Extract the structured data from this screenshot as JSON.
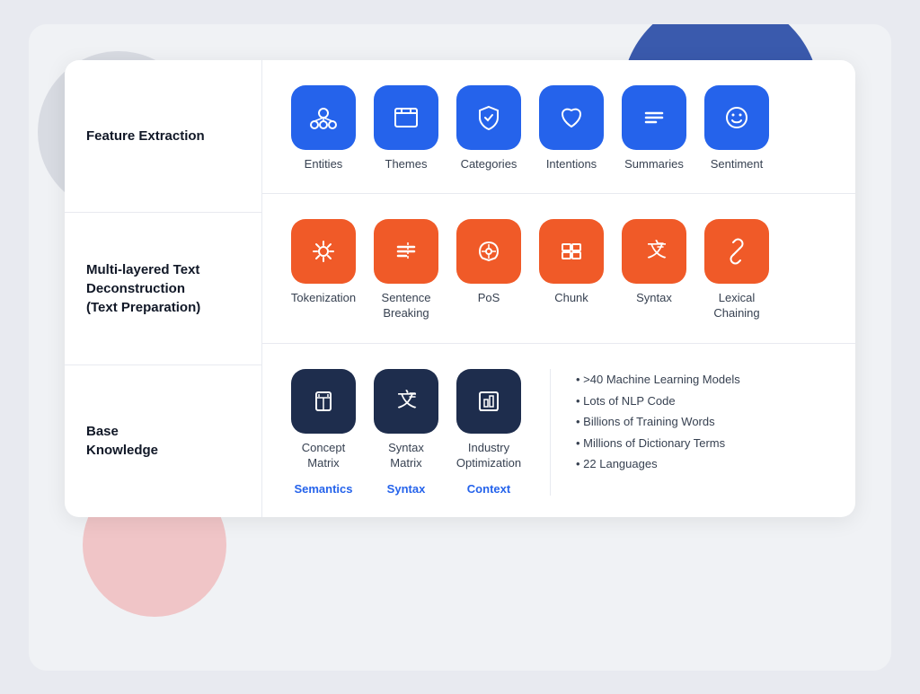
{
  "blobs": {
    "gray": "gray decorative circle",
    "blue": "blue decorative circle",
    "pink": "pink decorative circle"
  },
  "sidebar": {
    "items": [
      {
        "id": "feature-extraction",
        "label": "Feature\nExtraction"
      },
      {
        "id": "multi-layered",
        "label": "Multi-layered Text\nDeconstruction\n(Text Preparation)"
      },
      {
        "id": "base-knowledge",
        "label": "Base\nKnowledge"
      }
    ]
  },
  "sections": {
    "feature_extraction": {
      "icons": [
        {
          "id": "entities",
          "label": "Entities",
          "color": "blue"
        },
        {
          "id": "themes",
          "label": "Themes",
          "color": "blue"
        },
        {
          "id": "categories",
          "label": "Categories",
          "color": "blue"
        },
        {
          "id": "intentions",
          "label": "Intentions",
          "color": "blue"
        },
        {
          "id": "summaries",
          "label": "Summaries",
          "color": "blue"
        },
        {
          "id": "sentiment",
          "label": "Sentiment",
          "color": "blue"
        }
      ]
    },
    "text_preparation": {
      "icons": [
        {
          "id": "tokenization",
          "label": "Tokenization",
          "color": "orange"
        },
        {
          "id": "sentence-breaking",
          "label": "Sentence\nBreaking",
          "color": "orange"
        },
        {
          "id": "pos",
          "label": "PoS",
          "color": "orange"
        },
        {
          "id": "chunk",
          "label": "Chunk",
          "color": "orange"
        },
        {
          "id": "syntax",
          "label": "Syntax",
          "color": "orange"
        },
        {
          "id": "lexical-chaining",
          "label": "Lexical\nChaining",
          "color": "orange"
        }
      ]
    },
    "base_knowledge": {
      "icons": [
        {
          "id": "concept-matrix",
          "label": "Concept\nMatrix",
          "category": "Semantics"
        },
        {
          "id": "syntax-matrix",
          "label": "Syntax\nMatrix",
          "category": "Syntax"
        },
        {
          "id": "industry-optimization",
          "label": "Industry\nOptimization",
          "category": "Context"
        }
      ],
      "bullets": [
        ">40 Machine Learning Models",
        "Lots of NLP Code",
        "Billions of Training Words",
        "Millions of Dictionary Terms",
        "22 Languages"
      ]
    }
  }
}
